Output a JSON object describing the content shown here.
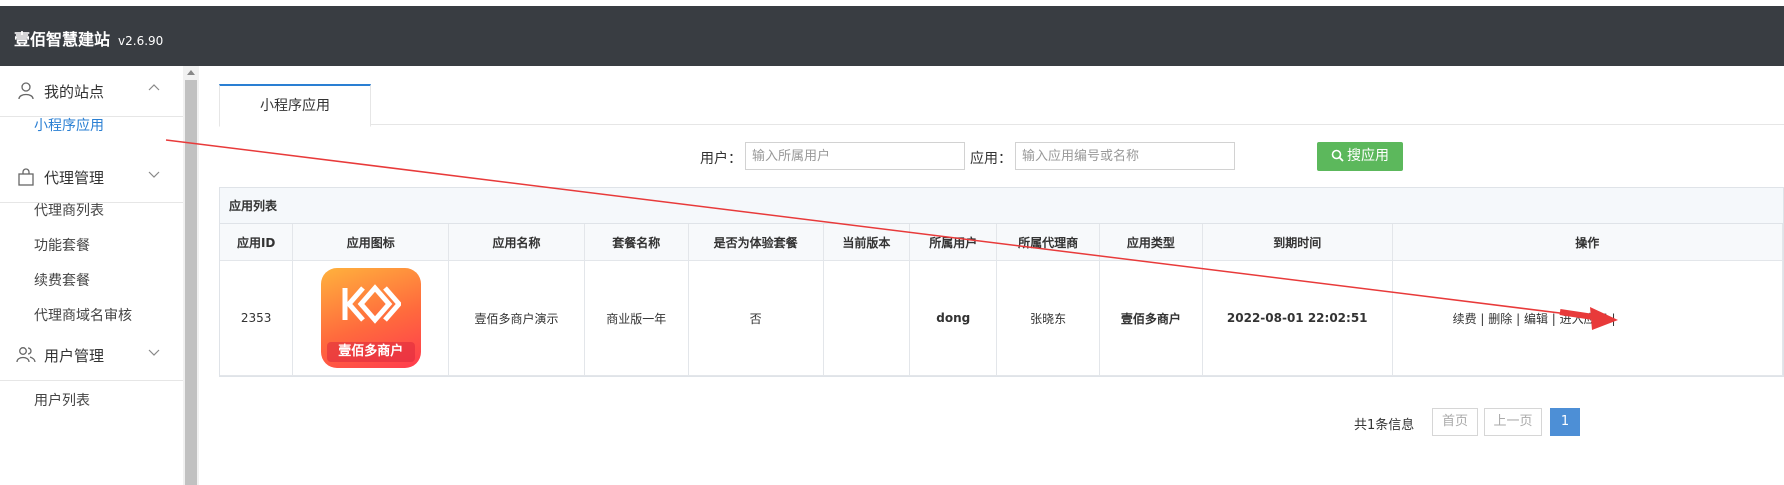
{
  "header": {
    "title": "壹佰智慧建站",
    "version": "v2.6.90"
  },
  "sidebar": {
    "groups": [
      {
        "label": "我的站点",
        "items": [
          "小程序应用"
        ]
      },
      {
        "label": "代理管理",
        "items": [
          "代理商列表",
          "功能套餐",
          "续费套餐",
          "代理商域名审核"
        ]
      },
      {
        "label": "用户管理",
        "items": [
          "用户列表"
        ]
      }
    ]
  },
  "tabs": [
    {
      "label": "小程序应用",
      "active": true
    }
  ],
  "search": {
    "user_label": "用户：",
    "user_placeholder": "输入所属用户",
    "app_label": "应用：",
    "app_placeholder": "输入应用编号或名称",
    "button_label": "搜应用",
    "button_color": "#5cb85c"
  },
  "panel": {
    "title": "应用列表",
    "columns": [
      "应用ID",
      "应用图标",
      "应用名称",
      "套餐名称",
      "是否为体验套餐",
      "当前版本",
      "所属用户",
      "所属代理商",
      "应用类型",
      "到期时间",
      "操作"
    ],
    "rows": [
      {
        "id": "2353",
        "icon_label": "壹佰多商户",
        "name": "壹佰多商户演示",
        "package": "商业版一年",
        "is_trial": "否",
        "version": "",
        "user": "dong",
        "agent": "张晓东",
        "type": "壹佰多商户",
        "expire": "2022-08-01 22:02:51",
        "ops": "续费 | 删除 | 编辑 | 进入应用 |"
      }
    ]
  },
  "pager": {
    "total": "共1条信息",
    "first": "首页",
    "prev": "上一页",
    "current": "1"
  },
  "colors": {
    "accent": "#2a7fd3",
    "header_bg": "#393d42",
    "annotation_arrow": "#e83a3a"
  }
}
